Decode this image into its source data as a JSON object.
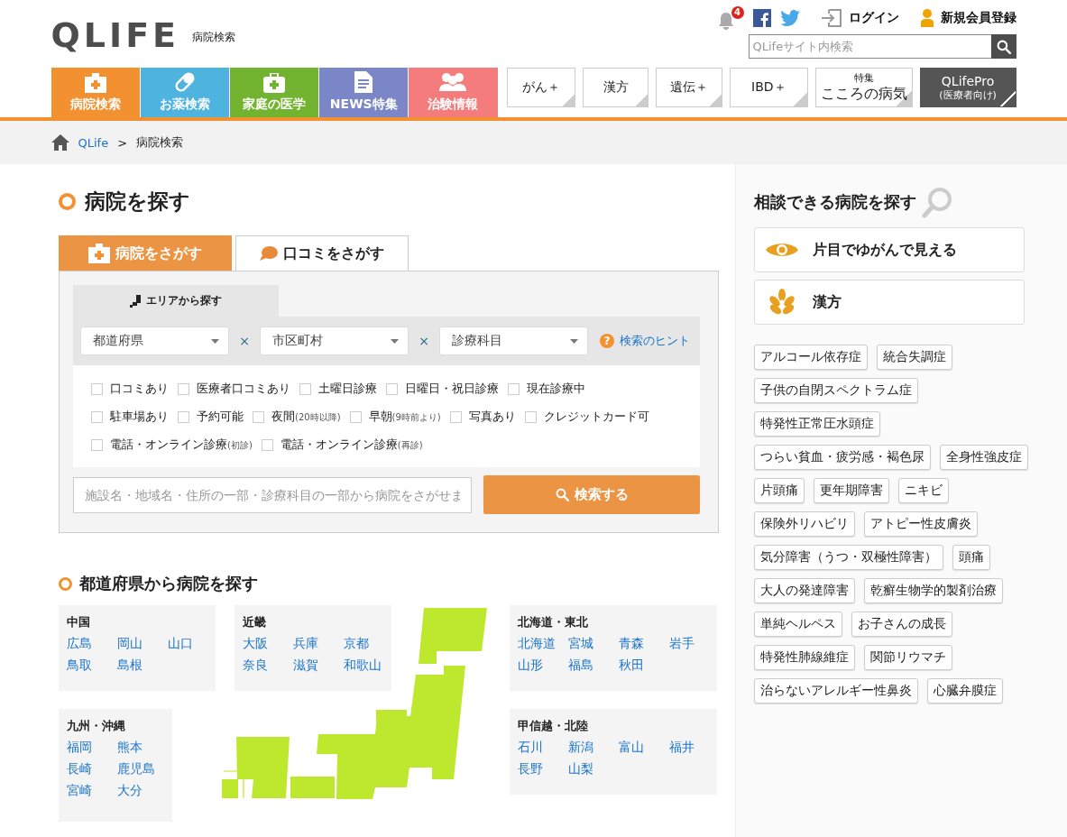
{
  "header": {
    "logo": "QLIFE",
    "logo_subtitle": "病院検索",
    "notification_count": "4",
    "login": "ログイン",
    "register": "新規会員登録",
    "site_search": {
      "placeholder": "QLifeサイト内検索"
    }
  },
  "main_nav": [
    {
      "label": "病院検索",
      "kind": "hospital",
      "color": "#f39131"
    },
    {
      "label": "お薬検索",
      "kind": "capsule",
      "color": "#4fb3e0"
    },
    {
      "label": "家庭の医学",
      "kind": "kit",
      "color": "#72b42f"
    },
    {
      "label": "NEWS特集",
      "kind": "document",
      "color": "#7a86c6"
    },
    {
      "label": "治験情報",
      "kind": "people",
      "color": "#f47c7c"
    }
  ],
  "sub_nav": [
    {
      "label": "がん＋",
      "kind": "plain"
    },
    {
      "label": "漢方",
      "kind": "plain"
    },
    {
      "label": "遺伝＋",
      "kind": "plain"
    },
    {
      "label": "IBD＋",
      "kind": "plain"
    },
    {
      "kicker": "特集",
      "label": "こころの病気",
      "kind": "plain"
    },
    {
      "label": "QLifePro",
      "sublabel": "(医療者向け)",
      "kind": "dark"
    }
  ],
  "breadcrumb": {
    "items": [
      "QLife",
      "病院検索"
    ],
    "separator": ">"
  },
  "hospital_search": {
    "title": "病院を探す",
    "tabs": [
      {
        "label": "病院をさがす",
        "kind": "hospital",
        "selected": true
      },
      {
        "label": "口コミをさがす",
        "kind": "speech",
        "selected": false
      }
    ],
    "area_tab": "エリアから探す",
    "selects": [
      {
        "placeholder": "都道府県"
      },
      {
        "placeholder": "市区町村"
      },
      {
        "placeholder": "診療科目"
      }
    ],
    "select_separator": "×",
    "hint_icon": "?",
    "hint_link": "検索のヒント",
    "filters": [
      [
        {
          "label": "口コミあり",
          "checked": false
        },
        {
          "label": "医療者口コミあり",
          "checked": false
        },
        {
          "label": "土曜日診療",
          "checked": false
        },
        {
          "label": "日曜日・祝日診療",
          "checked": false
        },
        {
          "label": "現在診療中",
          "checked": false
        }
      ],
      [
        {
          "label": "駐車場あり",
          "checked": false
        },
        {
          "label": "予約可能",
          "checked": false
        },
        {
          "label": "夜間",
          "note": "(20時以降)",
          "checked": false
        },
        {
          "label": "早朝",
          "note": "(9時前より)",
          "checked": false
        },
        {
          "label": "写真あり",
          "checked": false
        },
        {
          "label": "クレジットカード可",
          "checked": false
        }
      ],
      [
        {
          "label": "電話・オンライン診療",
          "note": "(初診)",
          "checked": false
        },
        {
          "label": "電話・オンライン診療",
          "note": "(再診)",
          "checked": false
        }
      ]
    ],
    "keyword": {
      "placeholder": "施設名・地域名・住所の一部・診療科目の一部から病院をさがせま"
    },
    "search_button": "検索する"
  },
  "prefecture_search": {
    "title": "都道府県から病院を探す",
    "regions": [
      {
        "name": "中国",
        "prefectures": [
          "広島",
          "岡山",
          "山口",
          "鳥取",
          "島根"
        ]
      },
      {
        "name": "近畿",
        "prefectures": [
          "大阪",
          "兵庫",
          "京都",
          "奈良",
          "滋賀",
          "和歌山"
        ]
      },
      {
        "name": "北海道・東北",
        "prefectures": [
          "北海道",
          "宮城",
          "青森",
          "岩手",
          "山形",
          "福島",
          "秋田"
        ]
      },
      {
        "name": "九州・沖縄",
        "prefectures": [
          "福岡",
          "熊本",
          "長崎",
          "鹿児島",
          "宮崎",
          "大分"
        ]
      },
      {
        "name": "甲信越・北陸",
        "prefectures": [
          "石川",
          "新潟",
          "富山",
          "福井",
          "長野",
          "山梨"
        ]
      }
    ]
  },
  "sidebar": {
    "title": "相談できる病院を探す",
    "features": [
      {
        "label": "片目でゆがんで見える",
        "kind": "eye"
      },
      {
        "label": "漢方",
        "kind": "leaf"
      }
    ],
    "tags": [
      "アルコール依存症",
      "統合失調症",
      "子供の自閉スペクトラム症",
      "特発性正常圧水頭症",
      "つらい貧血・疲労感・褐色尿",
      "全身性強皮症",
      "片頭痛",
      "更年期障害",
      "ニキビ",
      "保険外リハビリ",
      "アトピー性皮膚炎",
      "気分障害（うつ・双極性障害）",
      "頭痛",
      "大人の発達障害",
      "乾癬生物学的製剤治療",
      "単純ヘルペス",
      "お子さんの成長",
      "特発性肺線維症",
      "関節リウマチ",
      "治らないアレルギー性鼻炎",
      "心臓弁膜症"
    ]
  }
}
